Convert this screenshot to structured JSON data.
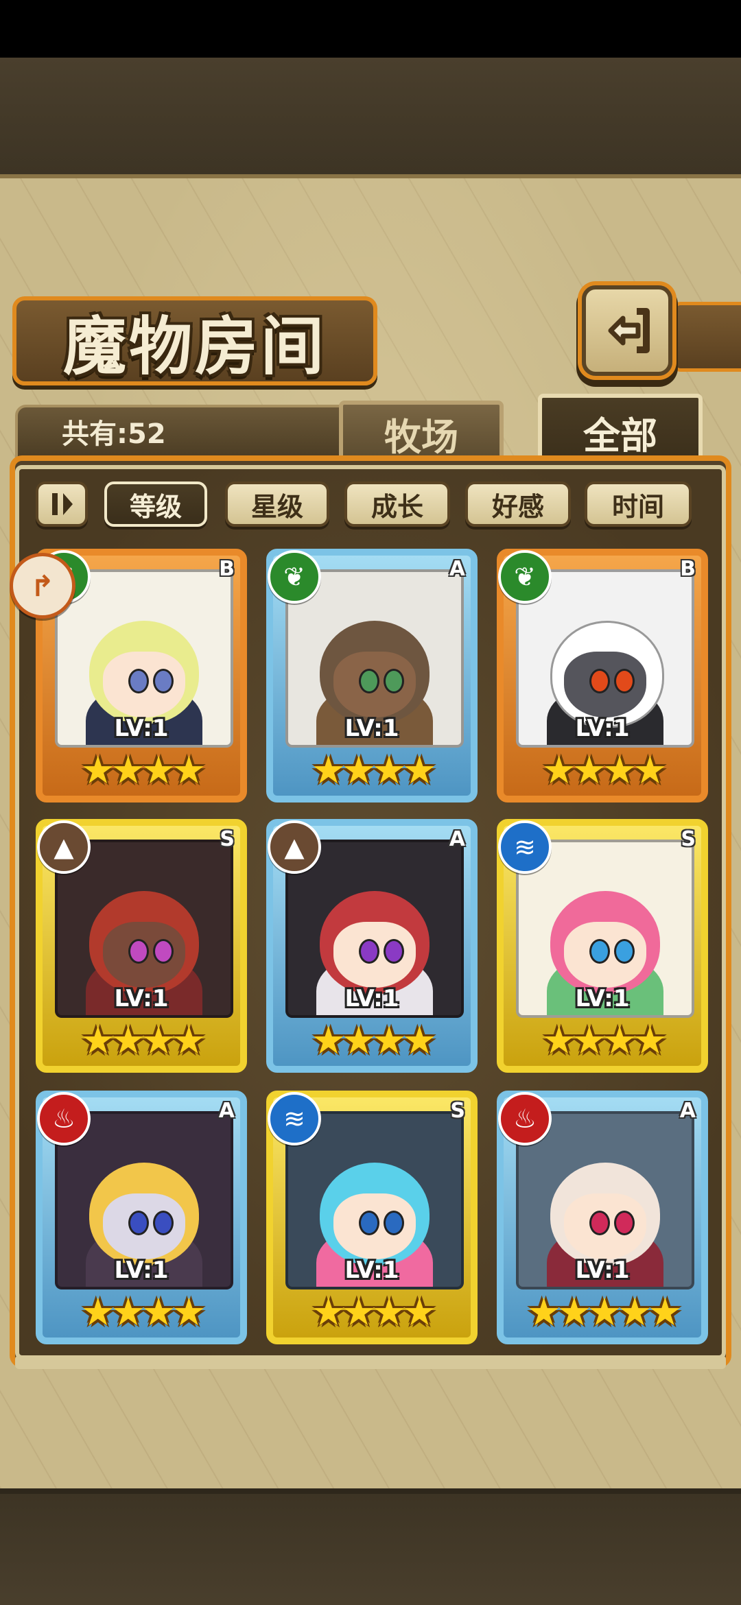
{
  "screen": {
    "title": "魔物房间",
    "count_label": "共有:52",
    "back_icon": "back-arrow-icon"
  },
  "tabs": [
    {
      "label": "牧场",
      "active": false
    },
    {
      "label": "全部",
      "active": true
    }
  ],
  "sort_buttons": [
    {
      "label": "等级",
      "active": true
    },
    {
      "label": "星级",
      "active": false
    },
    {
      "label": "成长",
      "active": false
    },
    {
      "label": "好感",
      "active": false
    },
    {
      "label": "时间",
      "active": false
    }
  ],
  "colors": {
    "frame_orange": "#e08a1e",
    "rarity_B": "#e98a2a",
    "rarity_A": "#7cc3e6",
    "rarity_S": "#f1d22f"
  },
  "monsters": [
    {
      "rank": "B",
      "element": "wood",
      "level": "LV:1",
      "stars": "★★★★",
      "favorite": true
    },
    {
      "rank": "A",
      "element": "wood",
      "level": "LV:1",
      "stars": "★★★★"
    },
    {
      "rank": "B",
      "element": "wood",
      "level": "LV:1",
      "stars": "★★★★"
    },
    {
      "rank": "S",
      "element": "earth",
      "level": "LV:1",
      "stars": "★★★★"
    },
    {
      "rank": "A",
      "element": "earth",
      "level": "LV:1",
      "stars": "★★★★"
    },
    {
      "rank": "S",
      "element": "water",
      "level": "LV:1",
      "stars": "★★★★"
    },
    {
      "rank": "A",
      "element": "fire",
      "level": "LV:1",
      "stars": "★★★★"
    },
    {
      "rank": "S",
      "element": "water",
      "level": "LV:1",
      "stars": "★★★★"
    },
    {
      "rank": "A",
      "element": "fire",
      "level": "LV:1",
      "stars": "★★★★★"
    }
  ]
}
